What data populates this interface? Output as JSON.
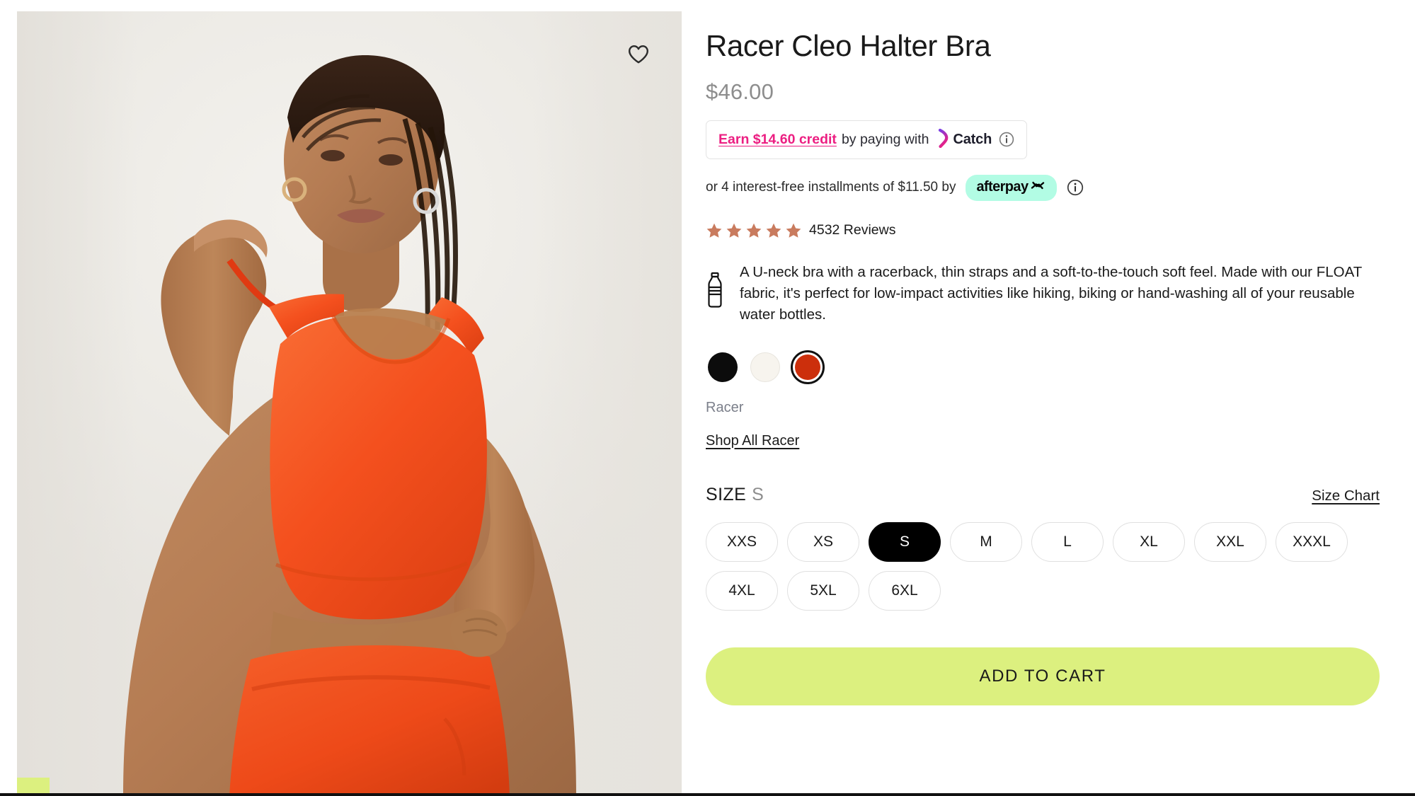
{
  "product": {
    "title": "Racer Cleo Halter Bra",
    "price": "$46.00",
    "description": "A U-neck bra with a racerback, thin straps and a soft-to-the-touch soft feel. Made with our FLOAT fabric, it's perfect for low-impact activities like hiking, biking or hand-washing all of your reusable water bottles.",
    "color_name": "Racer",
    "shop_all_label": "Shop All Racer"
  },
  "wishlist": {
    "icon": "heart-icon"
  },
  "catch": {
    "earn_label": "Earn $14.60 credit",
    "middle_label": "by paying with",
    "brand": "Catch",
    "info_icon": "info-icon",
    "accent_pink": "#EC1F82",
    "accent_purple": "#7B3FE4"
  },
  "afterpay": {
    "prefix": "or 4 interest-free installments of $11.50 by",
    "brand": "afterpay",
    "info_icon": "info-icon",
    "badge_color": "#B2FCE4"
  },
  "rating": {
    "stars": 5,
    "star_color": "#C97B5E",
    "reviews_label": "4532 Reviews"
  },
  "colors": {
    "swatches": [
      {
        "name": "Black",
        "hex": "#0C0C0C",
        "selected": false
      },
      {
        "name": "Ivory",
        "hex": "#F7F4EE",
        "selected": false
      },
      {
        "name": "Racer",
        "hex": "#CC2F0C",
        "selected": true
      }
    ]
  },
  "size": {
    "label": "SIZE",
    "selected": "S",
    "chart_link": "Size Chart",
    "options": [
      {
        "label": "XXS",
        "selected": false
      },
      {
        "label": "XS",
        "selected": false
      },
      {
        "label": "S",
        "selected": true
      },
      {
        "label": "M",
        "selected": false
      },
      {
        "label": "L",
        "selected": false
      },
      {
        "label": "XL",
        "selected": false
      },
      {
        "label": "XXL",
        "selected": false
      },
      {
        "label": "XXXL",
        "selected": false
      },
      {
        "label": "4XL",
        "selected": false
      },
      {
        "label": "5XL",
        "selected": false
      },
      {
        "label": "6XL",
        "selected": false
      }
    ]
  },
  "cart": {
    "add_label": "ADD TO CART",
    "button_color": "#DCF07F"
  },
  "gallery": {
    "alt": "Model wearing orange Racer Cleo Halter Bra",
    "garment_color": "#F4501E",
    "background_color": "#EFEDE9"
  }
}
